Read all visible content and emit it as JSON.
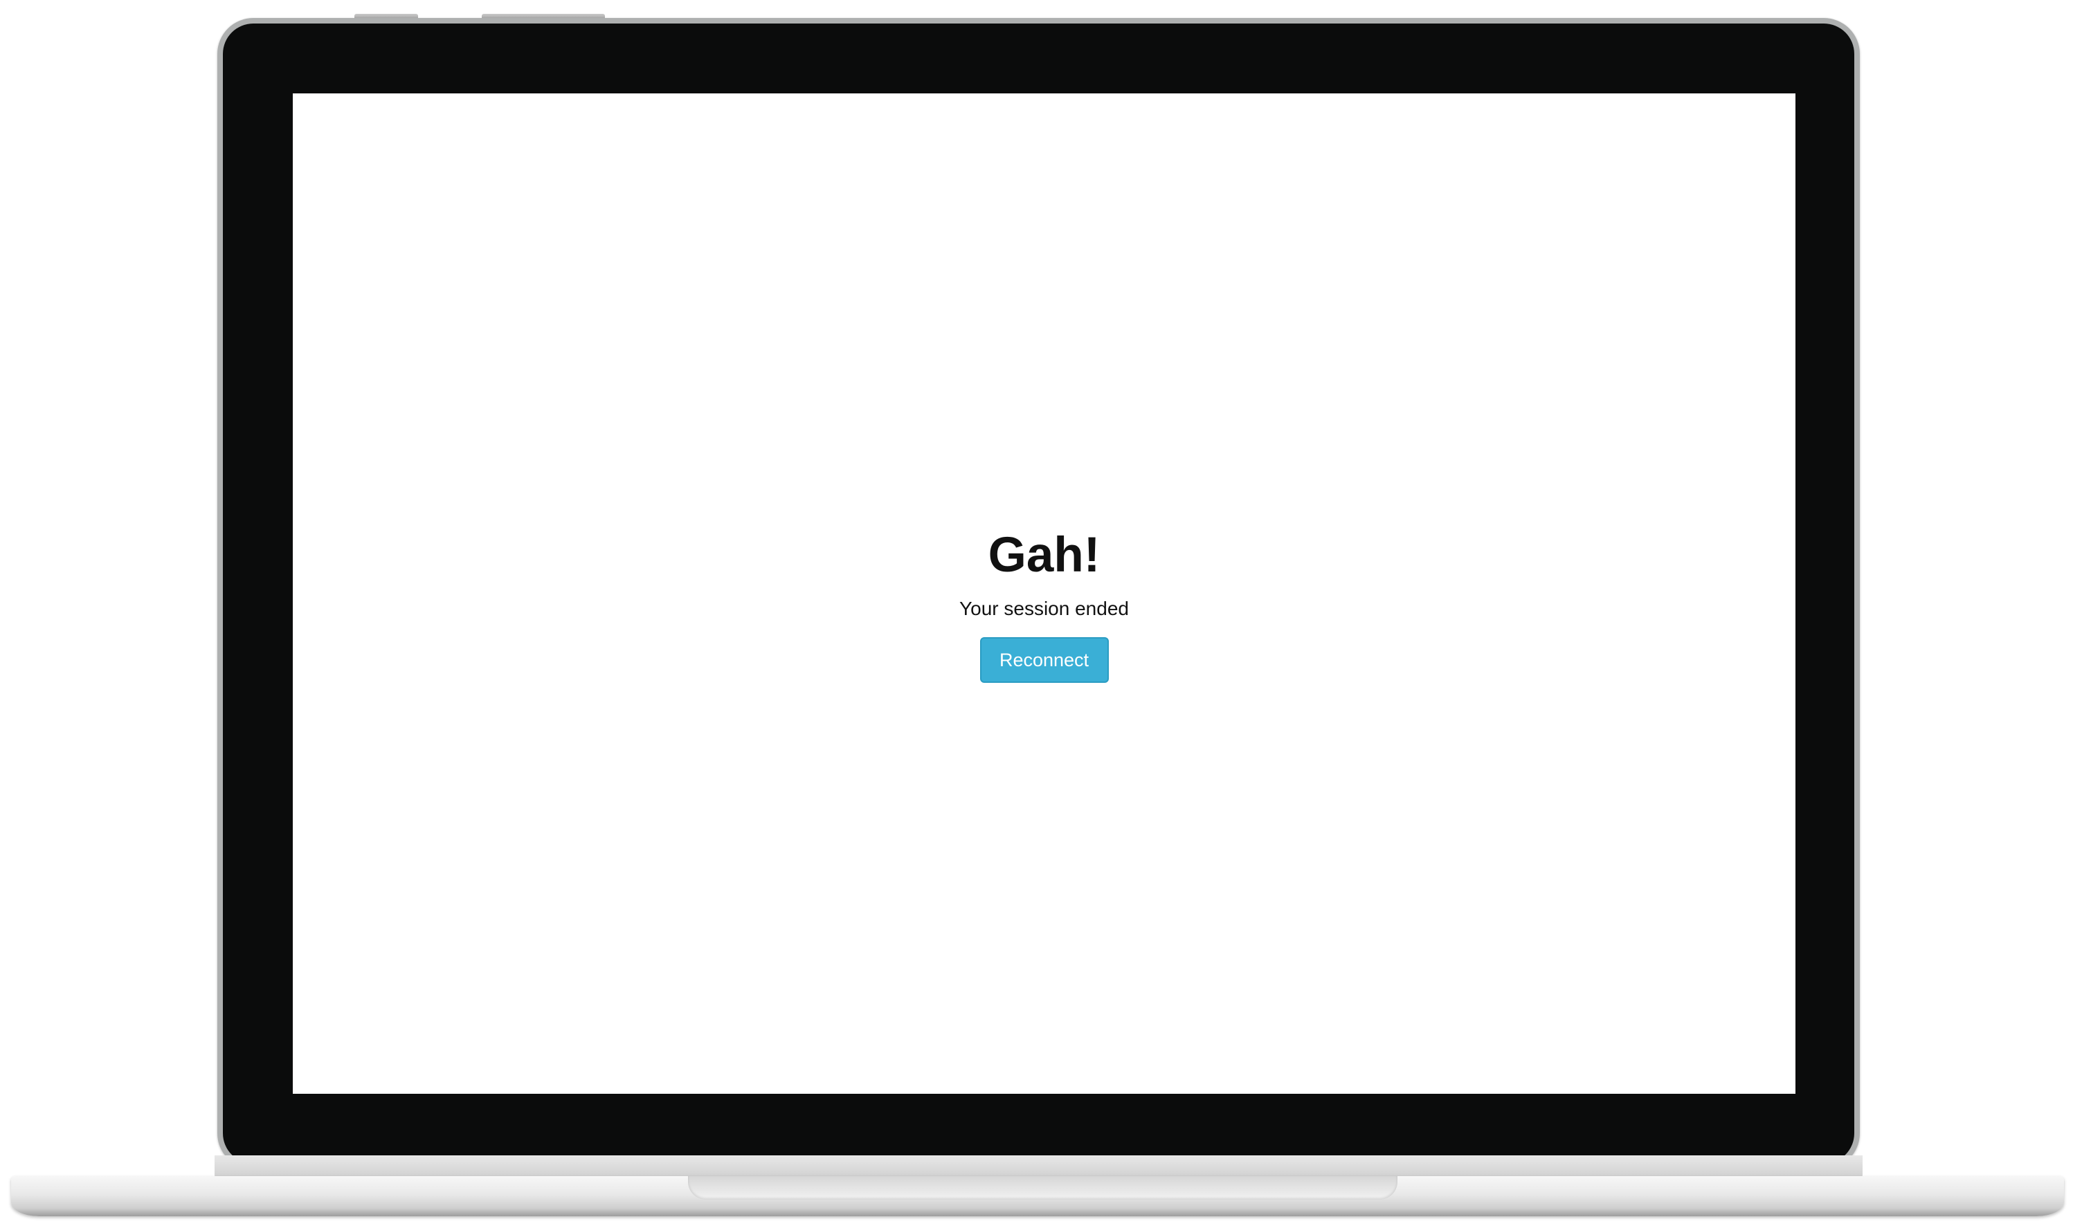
{
  "error_screen": {
    "headline": "Gah!",
    "message": "Your session ended",
    "reconnect_label": "Reconnect"
  },
  "colors": {
    "button_background": "#3aafd6",
    "button_border": "#2a9cc2",
    "button_text": "#ffffff",
    "screen_background": "#ffffff",
    "bezel": "#0b0c0c"
  }
}
